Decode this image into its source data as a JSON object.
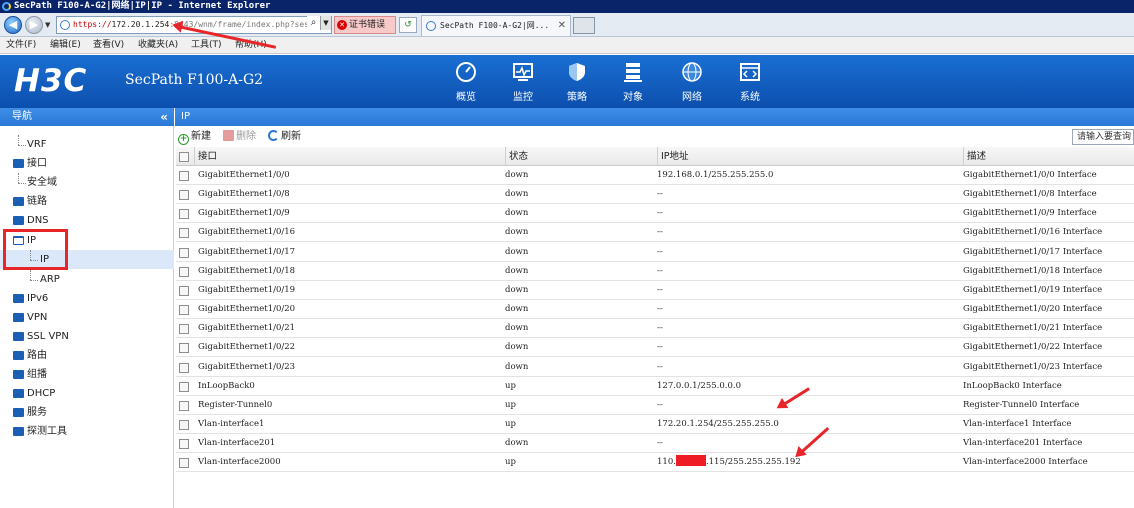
{
  "browser": {
    "title": "SecPath F100-A-G2|网络|IP|IP - Internet Explorer",
    "address_prefix": "https://",
    "address_host": "172.20.1.254",
    "address_rest": ":8443/wnm/frame/index.php?sess",
    "cert_error": "证书错误",
    "tab_label": "SecPath F100-A-G2|网...",
    "menu": [
      "文件(F)",
      "编辑(E)",
      "查看(V)",
      "收藏夹(A)",
      "工具(T)",
      "帮助(H)"
    ]
  },
  "header": {
    "logo": "H3C",
    "product": "SecPath F100-A-G2",
    "nav": [
      {
        "label": "概览",
        "icon": "gauge-icon"
      },
      {
        "label": "监控",
        "icon": "monitor-icon"
      },
      {
        "label": "策略",
        "icon": "shield-icon"
      },
      {
        "label": "对象",
        "icon": "server-icon"
      },
      {
        "label": "网络",
        "icon": "internet-globe-icon"
      },
      {
        "label": "系统",
        "icon": "code-window-icon"
      }
    ]
  },
  "sidebar": {
    "title": "导航",
    "collapse": "«",
    "items": [
      {
        "label": "VRF",
        "level": 1
      },
      {
        "label": "接口",
        "level": 0
      },
      {
        "label": "安全域",
        "level": 1
      },
      {
        "label": "链路",
        "level": 0
      },
      {
        "label": "DNS",
        "level": 0
      },
      {
        "label": "IP",
        "level": 0
      },
      {
        "label": "IP",
        "level": 2
      },
      {
        "label": "ARP",
        "level": 2
      },
      {
        "label": "IPv6",
        "level": 0
      },
      {
        "label": "VPN",
        "level": 0
      },
      {
        "label": "SSL VPN",
        "level": 0
      },
      {
        "label": "路由",
        "level": 0
      },
      {
        "label": "组播",
        "level": 0
      },
      {
        "label": "DHCP",
        "level": 0
      },
      {
        "label": "服务",
        "level": 0
      },
      {
        "label": "探测工具",
        "level": 0
      }
    ]
  },
  "content": {
    "title": "IP",
    "toolbar": {
      "new": "新建",
      "delete": "删除",
      "refresh": "刷新",
      "search_placeholder": "请输入要查询"
    },
    "columns": [
      "接口",
      "状态",
      "IP地址",
      "描述"
    ],
    "rows": [
      {
        "iface": "GigabitEthernet1/0/0",
        "status": "down",
        "ip": "192.168.0.1/255.255.255.0",
        "desc": "GigabitEthernet1/0/0 Interface"
      },
      {
        "iface": "GigabitEthernet1/0/8",
        "status": "down",
        "ip": "--",
        "desc": "GigabitEthernet1/0/8 Interface"
      },
      {
        "iface": "GigabitEthernet1/0/9",
        "status": "down",
        "ip": "--",
        "desc": "GigabitEthernet1/0/9 Interface"
      },
      {
        "iface": "GigabitEthernet1/0/16",
        "status": "down",
        "ip": "--",
        "desc": "GigabitEthernet1/0/16 Interface"
      },
      {
        "iface": "GigabitEthernet1/0/17",
        "status": "down",
        "ip": "--",
        "desc": "GigabitEthernet1/0/17 Interface"
      },
      {
        "iface": "GigabitEthernet1/0/18",
        "status": "down",
        "ip": "--",
        "desc": "GigabitEthernet1/0/18 Interface"
      },
      {
        "iface": "GigabitEthernet1/0/19",
        "status": "down",
        "ip": "--",
        "desc": "GigabitEthernet1/0/19 Interface"
      },
      {
        "iface": "GigabitEthernet1/0/20",
        "status": "down",
        "ip": "--",
        "desc": "GigabitEthernet1/0/20 Interface"
      },
      {
        "iface": "GigabitEthernet1/0/21",
        "status": "down",
        "ip": "--",
        "desc": "GigabitEthernet1/0/21 Interface"
      },
      {
        "iface": "GigabitEthernet1/0/22",
        "status": "down",
        "ip": "--",
        "desc": "GigabitEthernet1/0/22 Interface"
      },
      {
        "iface": "GigabitEthernet1/0/23",
        "status": "down",
        "ip": "--",
        "desc": "GigabitEthernet1/0/23 Interface"
      },
      {
        "iface": "InLoopBack0",
        "status": "up",
        "ip": "127.0.0.1/255.0.0.0",
        "desc": "InLoopBack0 Interface"
      },
      {
        "iface": "Register-Tunnel0",
        "status": "up",
        "ip": "--",
        "desc": "Register-Tunnel0 Interface"
      },
      {
        "iface": "Vlan-interface1",
        "status": "up",
        "ip": "172.20.1.254/255.255.255.0",
        "desc": "Vlan-interface1 Interface"
      },
      {
        "iface": "Vlan-interface201",
        "status": "down",
        "ip": "--",
        "desc": "Vlan-interface201 Interface"
      },
      {
        "iface": "Vlan-interface2000",
        "status": "up",
        "ip_prefix": "110.",
        "ip_suffix": ".115/255.255.255.192",
        "desc": "Vlan-interface2000 Interface"
      }
    ]
  }
}
